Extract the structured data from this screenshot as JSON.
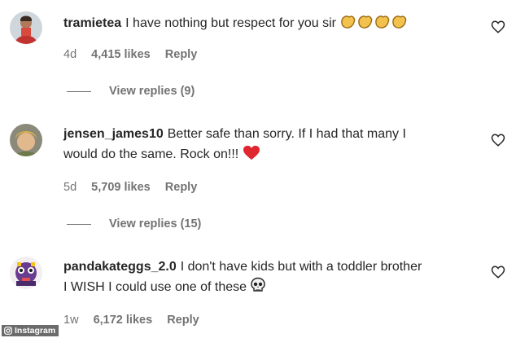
{
  "comments": [
    {
      "username": "tramietea",
      "text": "I have nothing but respect for you sir",
      "time": "4d",
      "likes": "4,415 likes",
      "reply": "Reply",
      "view_replies": "View replies (9)",
      "emoji": "clapping-hands-icon"
    },
    {
      "username": "jensen_james10",
      "text_line1": "Better safe than sorry. If I had that many I",
      "text_line2": "would do the same. Rock on!!!",
      "time": "5d",
      "likes": "5,709 likes",
      "reply": "Reply",
      "view_replies": "View replies (15)",
      "emoji": "red-heart-icon"
    },
    {
      "username": "pandakateggs_2.0",
      "text_line1": "I don't have kids but with a toddler brother",
      "text_line2": "I WISH I could use one of these",
      "time": "1w",
      "likes": "6,172 likes",
      "reply": "Reply",
      "emoji": "skull-icon"
    }
  ],
  "watermark": "Instagram"
}
